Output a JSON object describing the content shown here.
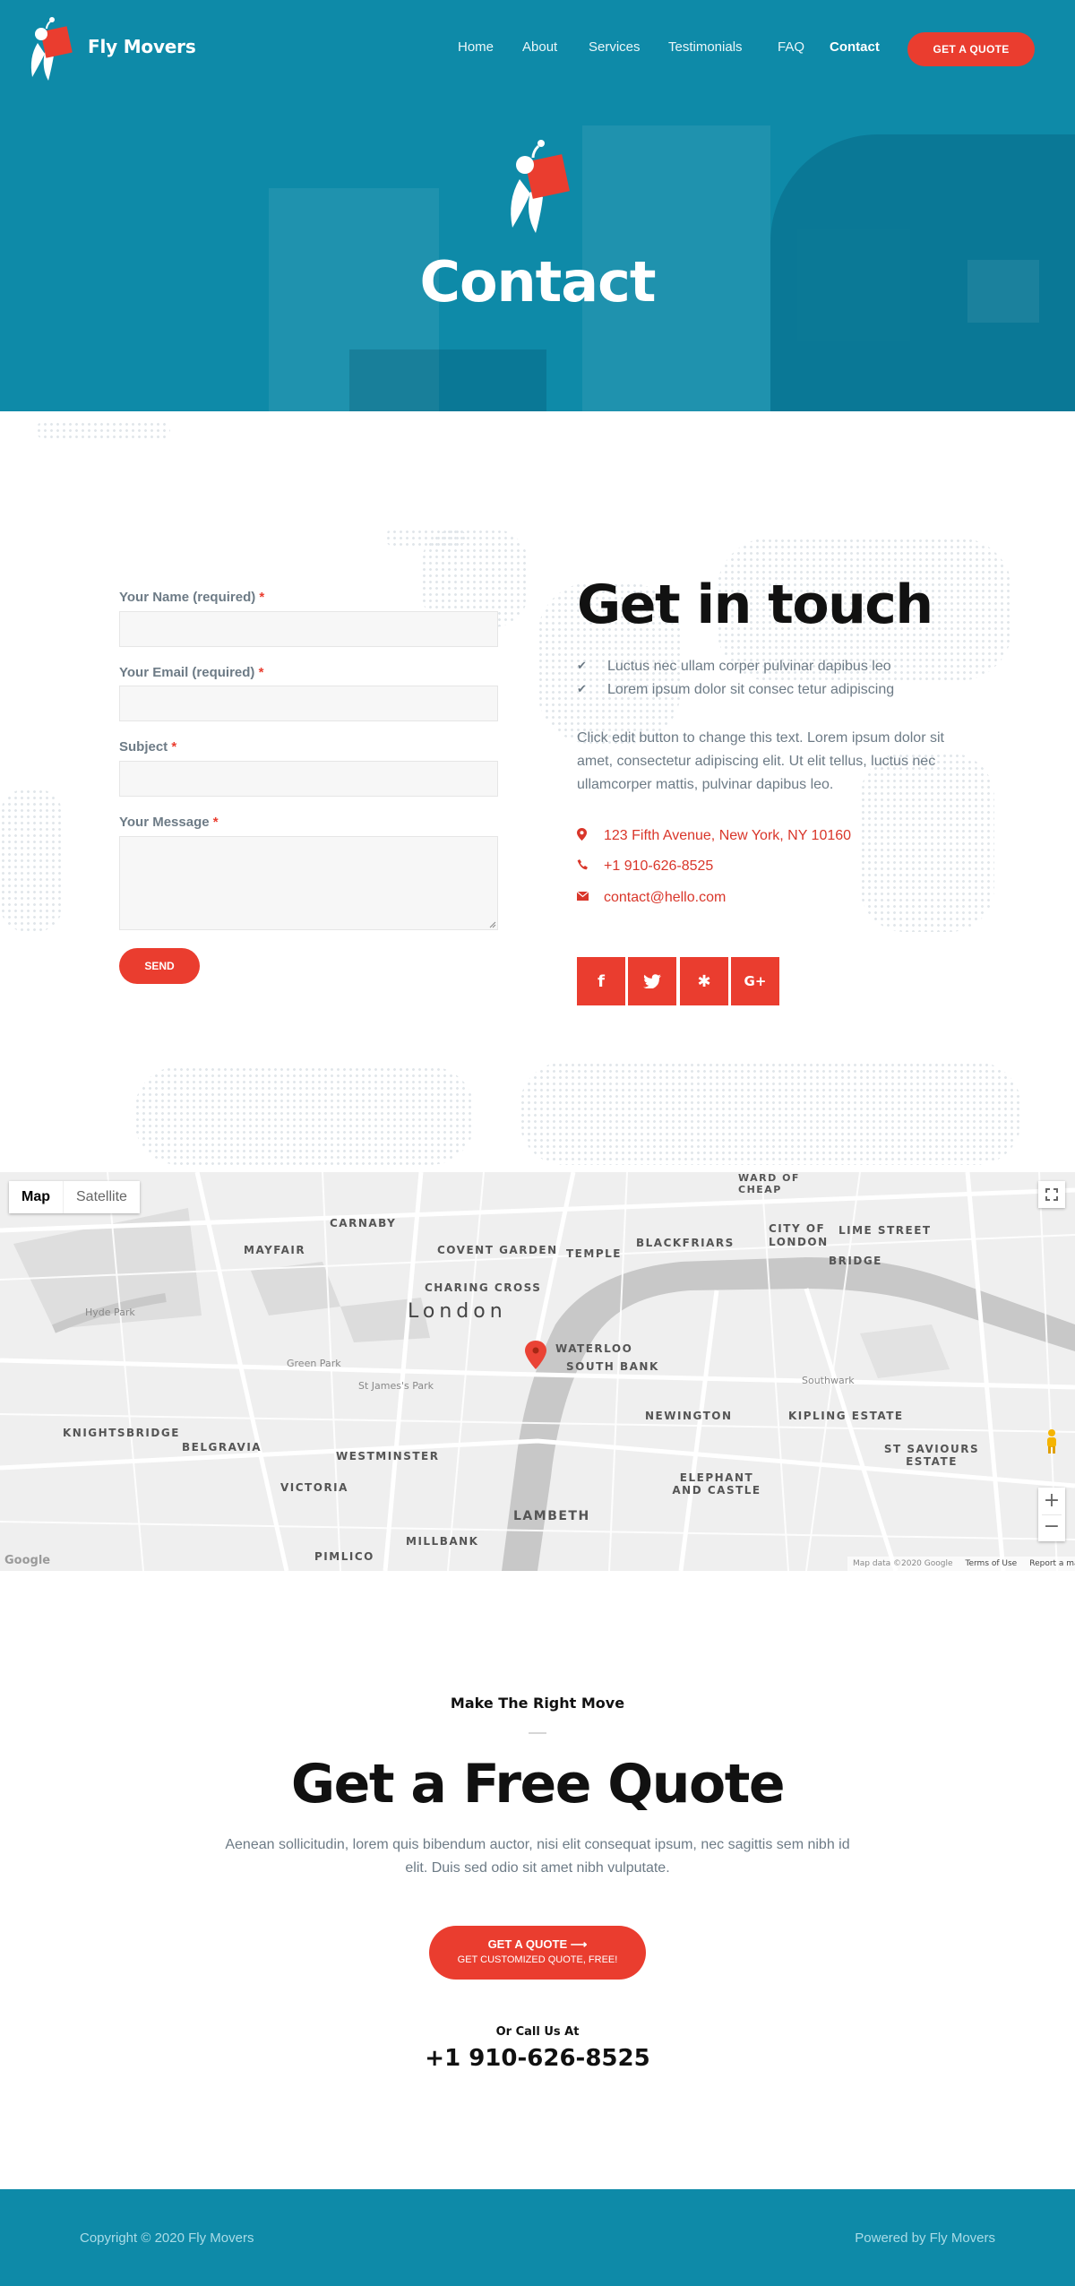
{
  "brand": {
    "name": "Fly Movers"
  },
  "nav": {
    "items": [
      "Home",
      "About",
      "Services",
      "Testimonials",
      "FAQ",
      "Contact"
    ],
    "active": "Contact",
    "cta": "GET A QUOTE"
  },
  "hero": {
    "title": "Contact"
  },
  "form": {
    "name_label": "Your Name (required)",
    "email_label": "Your Email (required)",
    "subject_label": "Subject",
    "message_label": "Your Message",
    "required_mark": "*",
    "send_label": "SEND"
  },
  "contact": {
    "title": "Get in touch",
    "checks": [
      "Luctus nec ullam corper pulvinar dapibus leo",
      "Lorem ipsum dolor sit consec tetur adipiscing"
    ],
    "paragraph": "Click edit button to change this text. Lorem ipsum dolor sit amet, consectetur adipiscing elit. Ut elit tellus, luctus nec ullamcorper mattis, pulvinar dapibus leo.",
    "address": "123 Fifth Avenue, New York, NY 10160",
    "phone": "+1 910-626-8525",
    "email": "contact@hello.com",
    "social": [
      {
        "icon": "facebook-icon",
        "glyph": "f"
      },
      {
        "icon": "twitter-icon",
        "glyph": "🐦"
      },
      {
        "icon": "yelp-icon",
        "glyph": "✱"
      },
      {
        "icon": "google-plus-icon",
        "glyph": "G+"
      }
    ]
  },
  "map": {
    "toggle": [
      "Map",
      "Satellite"
    ],
    "labels": [
      "MAYFAIR",
      "CARNABY",
      "COVENT GARDEN",
      "TEMPLE",
      "BLACKFRIARS",
      "CITY OF LONDON",
      "LIME STREET",
      "BRIDGE",
      "WARD OF CHEAP",
      "CHARING CROSS",
      "London",
      "WATERLOO",
      "SOUTH BANK",
      "NEWINGTON",
      "KIPLING ESTATE",
      "ST SAVIOURS ESTATE",
      "ELEPHANT AND CASTLE",
      "LAMBETH",
      "KNIGHTSBRIDGE",
      "BELGRAVIA",
      "WESTMINSTER",
      "VICTORIA",
      "PIMLICO",
      "MILLBANK",
      "Hyde Park",
      "Green Park",
      "St James's Park",
      "Southwark"
    ],
    "footer": [
      "Map data ©2020 Google",
      "Terms of Use",
      "Report a map error"
    ]
  },
  "quote": {
    "eyebrow": "Make The Right Move",
    "title": "Get a Free Quote",
    "paragraph": "Aenean sollicitudin, lorem quis bibendum auctor, nisi elit consequat ipsum, nec sagittis sem nibh id elit. Duis sed odio sit amet nibh vulputate.",
    "button_line1": "GET A QUOTE",
    "button_line2": "GET CUSTOMIZED QUOTE, FREE!",
    "call_label": "Or Call Us At",
    "phone": "+1 910-626-8525"
  },
  "footer": {
    "copyright": "Copyright © 2020 Fly Movers",
    "powered": "Powered by Fly Movers"
  },
  "colors": {
    "primary": "#0e8aa8",
    "accent": "#ea3d2f",
    "text_muted": "#6d7b86"
  }
}
